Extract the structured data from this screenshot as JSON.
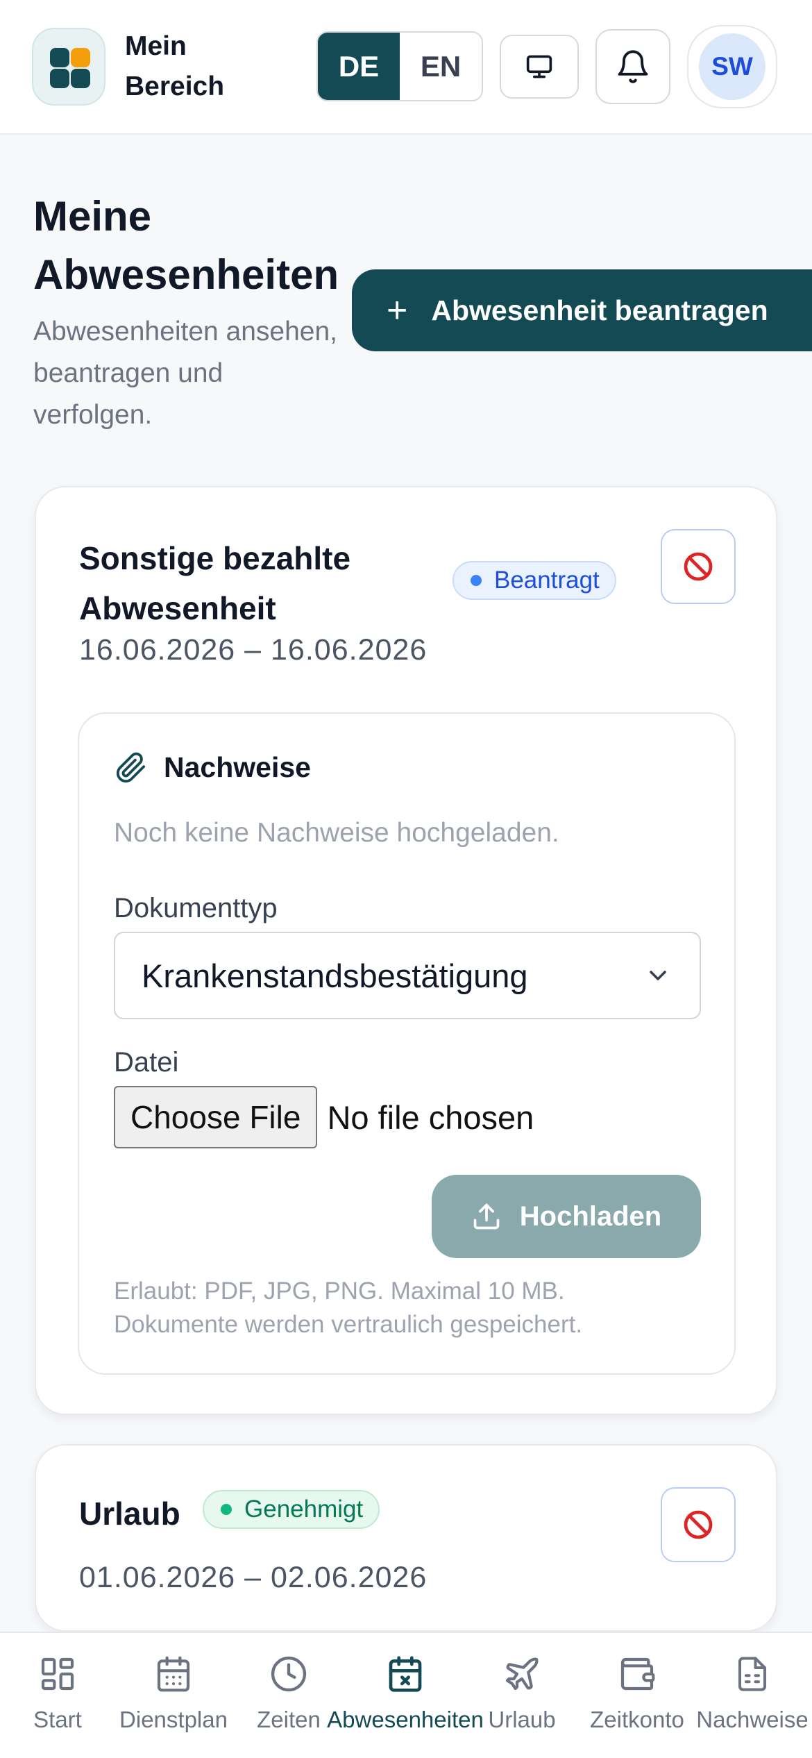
{
  "header": {
    "brand": "Mein Bereich",
    "languages": [
      "DE",
      "EN"
    ],
    "active_language": "DE",
    "avatar_initials": "SW"
  },
  "page": {
    "title": "Meine Abwesenheiten",
    "subtitle": "Abwesenheiten ansehen, beantragen und verfolgen.",
    "new_request_label": "Abwesenheit beantragen"
  },
  "absences": [
    {
      "type": "Sonstige bezahlte Abwesenheit",
      "status": "Beantragt",
      "dates": "16.06.2026 – 16.06.2026"
    },
    {
      "type": "Urlaub",
      "status": "Genehmigt",
      "dates": "01.06.2026 – 02.06.2026"
    }
  ],
  "proofs": {
    "heading": "Nachweise",
    "empty_text": "Noch keine Nachweise hochgeladen.",
    "doc_type_label": "Dokumenttyp",
    "doc_type_value": "Krankenstandsbestätigung",
    "file_label": "Datei",
    "choose_file": "Choose File",
    "no_file": "No file chosen",
    "upload_label": "Hochladen",
    "hint": "Erlaubt: PDF, JPG, PNG. Maximal 10 MB. Dokumente werden vertraulich gespeichert."
  },
  "nav": [
    {
      "label": "Start",
      "icon": "grid-icon"
    },
    {
      "label": "Dienstplan",
      "icon": "calendar-icon"
    },
    {
      "label": "Zeiten",
      "icon": "clock-icon"
    },
    {
      "label": "Abwesenheiten",
      "icon": "calendar-x-icon",
      "active": true
    },
    {
      "label": "Urlaub",
      "icon": "plane-icon"
    },
    {
      "label": "Zeitkonto",
      "icon": "wallet-icon"
    },
    {
      "label": "Nachweise",
      "icon": "document-icon"
    }
  ],
  "colors": {
    "primary": "#134a54",
    "accent": "#f59e0b",
    "status_requested": "#1d4ed8",
    "status_approved": "#047857",
    "danger": "#dc2626"
  }
}
